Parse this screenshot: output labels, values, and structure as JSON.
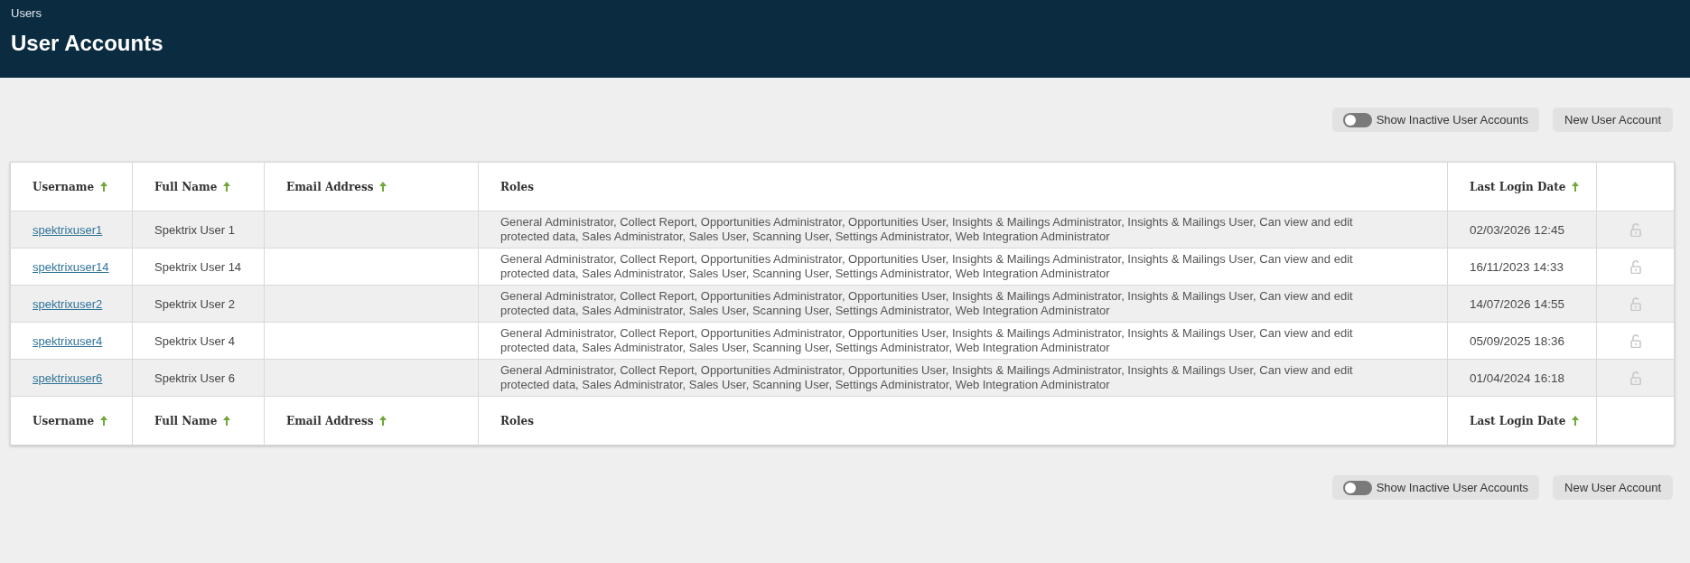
{
  "header": {
    "breadcrumb": "Users",
    "title": "User Accounts"
  },
  "top_toolbar": {
    "toggle": {
      "label": "Show Inactive User Accounts",
      "on": false
    },
    "button": "New User Account"
  },
  "table": {
    "columns": [
      {
        "label": "Username",
        "sortable": true
      },
      {
        "label": "Full Name",
        "sortable": true
      },
      {
        "label": "Email Address",
        "sortable": true
      },
      {
        "label": "Roles",
        "sortable": false
      },
      {
        "label": "Last Login Date",
        "sortable": true
      }
    ],
    "rows": [
      {
        "username": "spektrixuser1",
        "full_name": "Spektrix User 1",
        "roles": "General Administrator, Collect Report, Opportunities Administrator, Opportunities User, Insights & Mailings Administrator, Insights & Mailings User, Can view and edit protected data, Sales Administrator, Sales User, Scanning User, Settings Administrator, Web Integration Administrator",
        "last_login": "02/03/2026 12:45",
        "locked": false
      },
      {
        "username": "spektrixuser14",
        "full_name": "Spektrix User 14",
        "roles": "General Administrator, Collect Report, Opportunities Administrator, Opportunities User, Insights & Mailings Administrator, Insights & Mailings User, Can view and edit protected data, Sales Administrator, Sales User, Scanning User, Settings Administrator, Web Integration Administrator",
        "last_login": "16/11/2023 14:33",
        "locked": false
      },
      {
        "username": "spektrixuser2",
        "full_name": "Spektrix User 2",
        "roles": "General Administrator, Collect Report, Opportunities Administrator, Opportunities User, Insights & Mailings Administrator, Insights & Mailings User, Can view and edit protected data, Sales Administrator, Sales User, Scanning User, Settings Administrator, Web Integration Administrator",
        "last_login": "14/07/2026 14:55",
        "locked": false
      },
      {
        "username": "spektrixuser4",
        "full_name": "Spektrix User 4",
        "roles": "General Administrator, Collect Report, Opportunities Administrator, Opportunities User, Insights & Mailings Administrator, Insights & Mailings User, Can view and edit protected data, Sales Administrator, Sales User, Scanning User, Settings Administrator, Web Integration Administrator",
        "last_login": "05/09/2025 18:36",
        "locked": false
      },
      {
        "username": "spektrixuser6",
        "full_name": "Spektrix User 6",
        "roles": "General Administrator, Collect Report, Opportunities Administrator, Opportunities User, Insights & Mailings Administrator, Insights & Mailings User, Can view and edit protected data, Sales Administrator, Sales User, Scanning User, Settings Administrator, Web Integration Administrator",
        "last_login": "01/04/2024 16:18",
        "locked": false
      }
    ],
    "footer_columns": [
      {
        "label": "Username",
        "sortable": true
      },
      {
        "label": "Full Name",
        "sortable": true
      },
      {
        "label": "Email Address",
        "sortable": true
      },
      {
        "label": "Roles",
        "sortable": false
      },
      {
        "label": "Last Login Date",
        "sortable": true
      }
    ]
  },
  "bottom_toolbar": {
    "toggle": {
      "label": "Show Inactive User Accounts",
      "on": false
    },
    "button": "New User Account"
  }
}
